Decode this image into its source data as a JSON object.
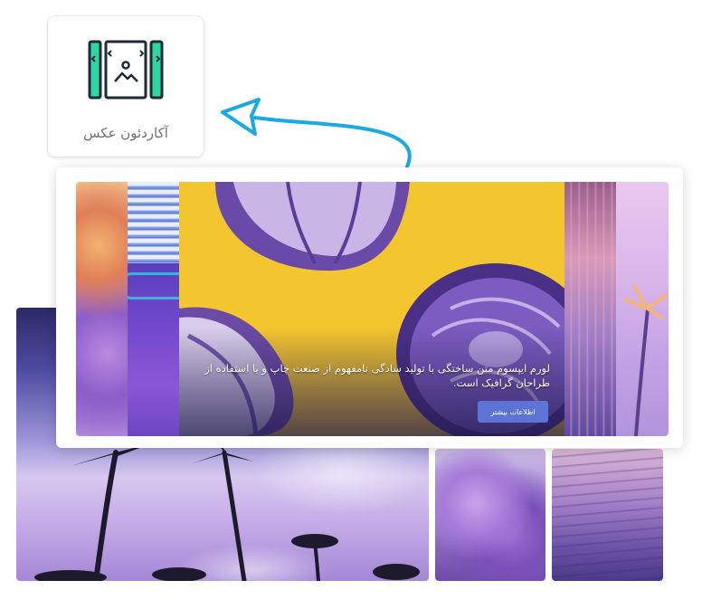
{
  "widget": {
    "label": "آکاردئون عکس",
    "icon": "image-accordion-icon",
    "icon_color": "#2fd6a3",
    "outline_color": "#1e2a3a"
  },
  "arrow": {
    "color": "#1aa9e3",
    "icon": "curved-arrow-icon"
  },
  "accordion": {
    "caption": "لورم ایپسوم متن ساختگی با تولید سادگی نامفهوم از صنعت چاپ و با استفاده از طراحان گرافیک است.",
    "button_label": "اطلاعات بیشتر",
    "button_color": "#5b74d6"
  }
}
